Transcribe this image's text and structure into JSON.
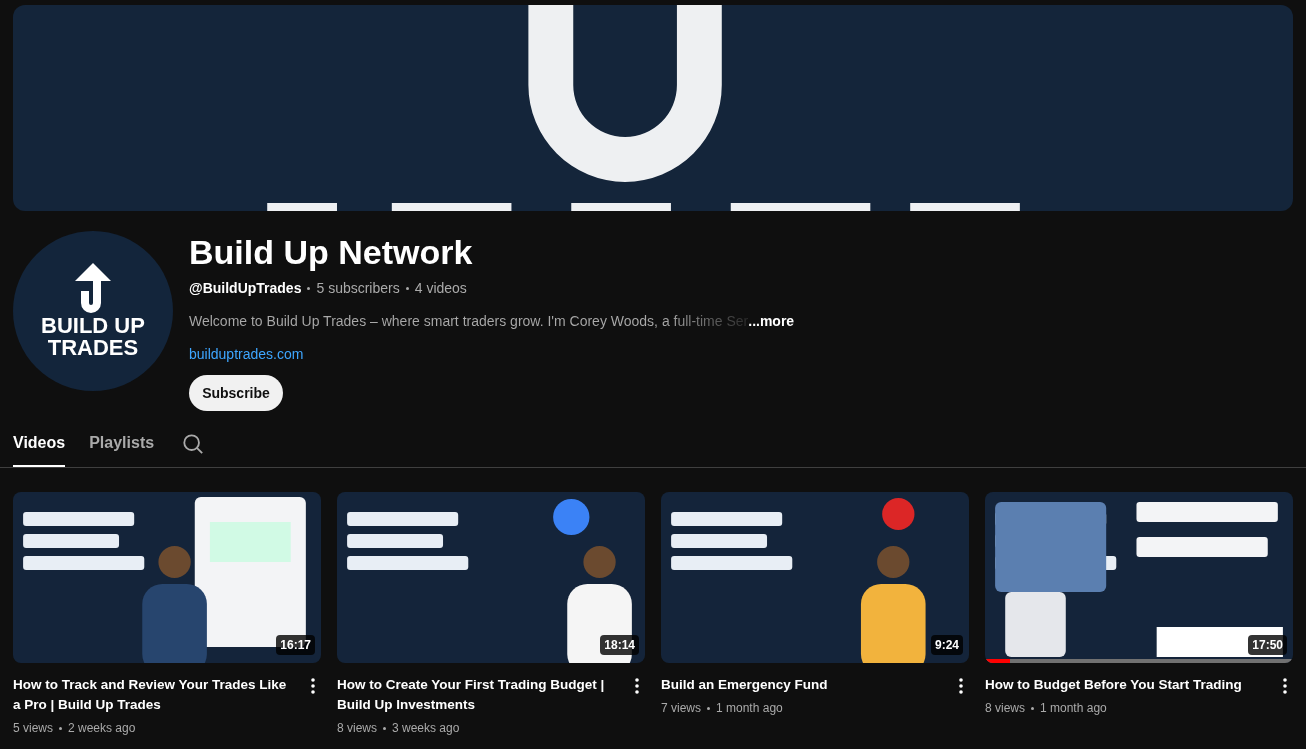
{
  "channel": {
    "avatar_text": [
      "BUILD UP",
      "TRADES"
    ],
    "name": "Build Up Network",
    "handle": "@BuildUpTrades",
    "subscribers": "5 subscribers",
    "videos_count": "4 videos",
    "description": "Welcome to Build Up Trades – where smart traders grow. I'm Corey Woods, a full-time Ser",
    "more": "...more",
    "link": "builduptrades.com",
    "subscribe": "Subscribe"
  },
  "tabs": [
    {
      "label": "Videos",
      "selected": true
    },
    {
      "label": "Playlists",
      "selected": false
    }
  ],
  "videos": [
    {
      "title": "How to Track and Review Your Trades Like a Pro | Build Up Trades",
      "duration": "16:17",
      "views": "5 views",
      "age": "2 weeks ago"
    },
    {
      "title": "How to Create Your First Trading Budget | Build Up Investments",
      "duration": "18:14",
      "views": "8 views",
      "age": "3 weeks ago"
    },
    {
      "title": "Build an Emergency Fund",
      "duration": "9:24",
      "views": "7 views",
      "age": "1 month ago"
    },
    {
      "title": "How to Budget Before You Start Trading",
      "duration": "17:50",
      "views": "8 views",
      "age": "1 month ago",
      "watch_progress": {
        "level": 0.08
      }
    }
  ]
}
